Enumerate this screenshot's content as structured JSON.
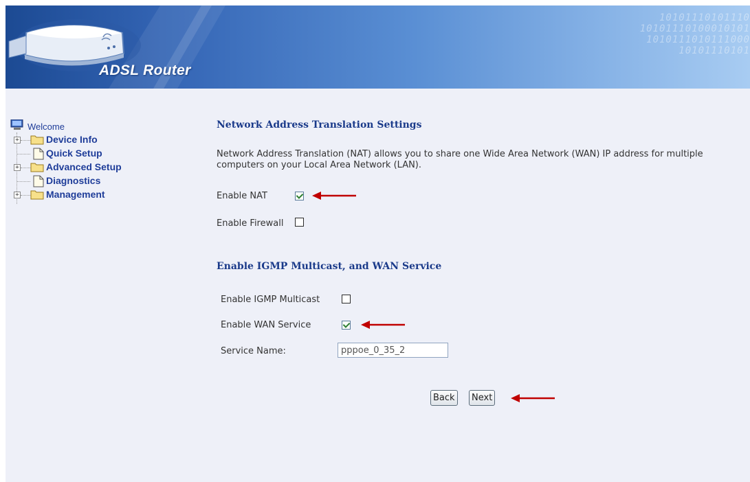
{
  "banner": {
    "brand": "ADSL Router",
    "binary_lines": [
      "10101110101110",
      "10101110100010101",
      "1010111010111000",
      "10101110101"
    ]
  },
  "sidebar": {
    "root": {
      "label": "Welcome",
      "icon": "computer-icon"
    },
    "items": [
      {
        "label": "Device Info",
        "icon": "folder-icon",
        "expandable": true
      },
      {
        "label": "Quick Setup",
        "icon": "document-icon",
        "expandable": false
      },
      {
        "label": "Advanced Setup",
        "icon": "folder-icon",
        "expandable": true
      },
      {
        "label": "Diagnostics",
        "icon": "document-icon",
        "expandable": false
      },
      {
        "label": "Management",
        "icon": "folder-icon",
        "expandable": true
      }
    ]
  },
  "nat_section": {
    "title": "Network Address Translation Settings",
    "description": "Network Address Translation (NAT) allows you to share one Wide Area Network (WAN) IP address for multiple computers on your Local Area Network (LAN).",
    "enable_nat_label": "Enable NAT",
    "enable_nat_checked": true,
    "enable_firewall_label": "Enable Firewall",
    "enable_firewall_checked": false
  },
  "igmp_section": {
    "title": "Enable IGMP Multicast, and WAN Service",
    "igmp_label": "Enable IGMP Multicast",
    "igmp_checked": false,
    "wan_label": "Enable WAN Service",
    "wan_checked": true,
    "service_name_label": "Service Name:",
    "service_name_value": "pppoe_0_35_2"
  },
  "buttons": {
    "back": "Back",
    "next": "Next"
  },
  "colors": {
    "heading": "#1a3a8a",
    "nav_link": "#1f3d99",
    "annotation_arrow": "#c00000",
    "page_bg": "#eef0f8"
  }
}
